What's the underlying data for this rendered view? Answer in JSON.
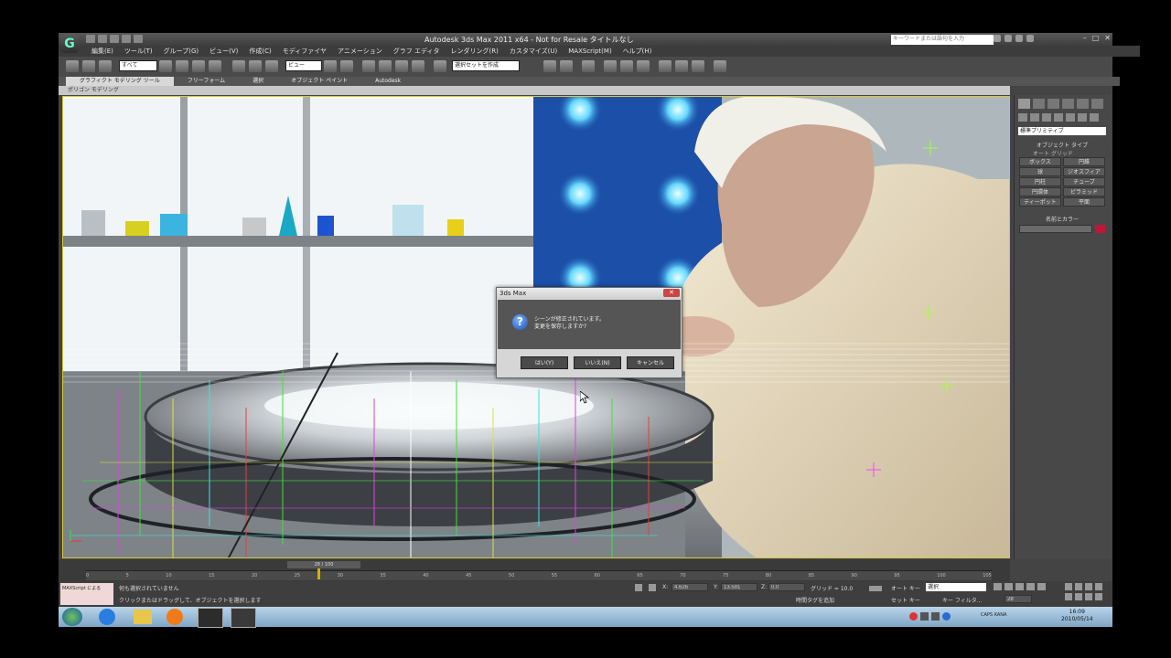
{
  "titlebar": {
    "title": "Autodesk 3ds Max  2011 x64 - Not for Resale   タイトルなし",
    "search_placeholder": "キーワードまたは語句を入力"
  },
  "menu": [
    "編集(E)",
    "ツール(T)",
    "グループ(G)",
    "ビュー(V)",
    "作成(C)",
    "モディファイヤ",
    "アニメーション",
    "グラフ エディタ",
    "レンダリング(R)",
    "カスタマイズ(U)",
    "MAXScript(M)",
    "ヘルプ(H)"
  ],
  "toolbar": {
    "filter_value": "すべて",
    "view_value": "ビュー",
    "selection_set": "選択セットを作成"
  },
  "ribbon": {
    "tabs": [
      "グラフィクト モデリング ツール",
      "フリーフォーム",
      "選択",
      "オブジェクト ペイント",
      "Autodesk"
    ],
    "sub": "ポリゴン モデリング"
  },
  "panel": {
    "category": "標準プリミティブ",
    "object_type_title": "オブジェクト タイプ",
    "autogrid": "オート グリッド",
    "buttons": [
      "ボックス",
      "円錐",
      "球",
      "ジオスフィア",
      "円柱",
      "チューブ",
      "円環体",
      "ピラミッド",
      "ティーポット",
      "平面"
    ],
    "name_color_title": "名前とカラー"
  },
  "dialog": {
    "title": "3ds Max",
    "line1": "シーンが修正されています。",
    "line2": "変更を保存しますか?",
    "yes": "はい(Y)",
    "no": "いいえ(N)",
    "cancel": "キャンセル"
  },
  "timeline": {
    "frame": "28 / 100",
    "ticks": [
      "0",
      "5",
      "10",
      "15",
      "20",
      "25",
      "30",
      "35",
      "40",
      "45",
      "50",
      "55",
      "60",
      "65",
      "70",
      "75",
      "80",
      "85",
      "90",
      "95",
      "100",
      "105"
    ]
  },
  "status": {
    "maxscript": "MAXScript による",
    "line1": "何も選択されていません",
    "line2": "クリックまたはドラッグして、オブジェクトを選択します",
    "x_label": "X:",
    "x_value": "4.626",
    "y_label": "Y:",
    "y_value": "13.591",
    "z_label": "Z:",
    "z_value": "0.0",
    "grid": "グリッド = 10.0",
    "autokey": "オート キー",
    "setkey": "セット キー",
    "selected": "選択",
    "keyfilter": "キー フィルタ...",
    "addtime": "時間タグを追加",
    "frame_field": "28"
  },
  "taskbar": {
    "clock_time": "16:09",
    "clock_date": "2010/05/14",
    "lang": "CAPS KANA"
  }
}
